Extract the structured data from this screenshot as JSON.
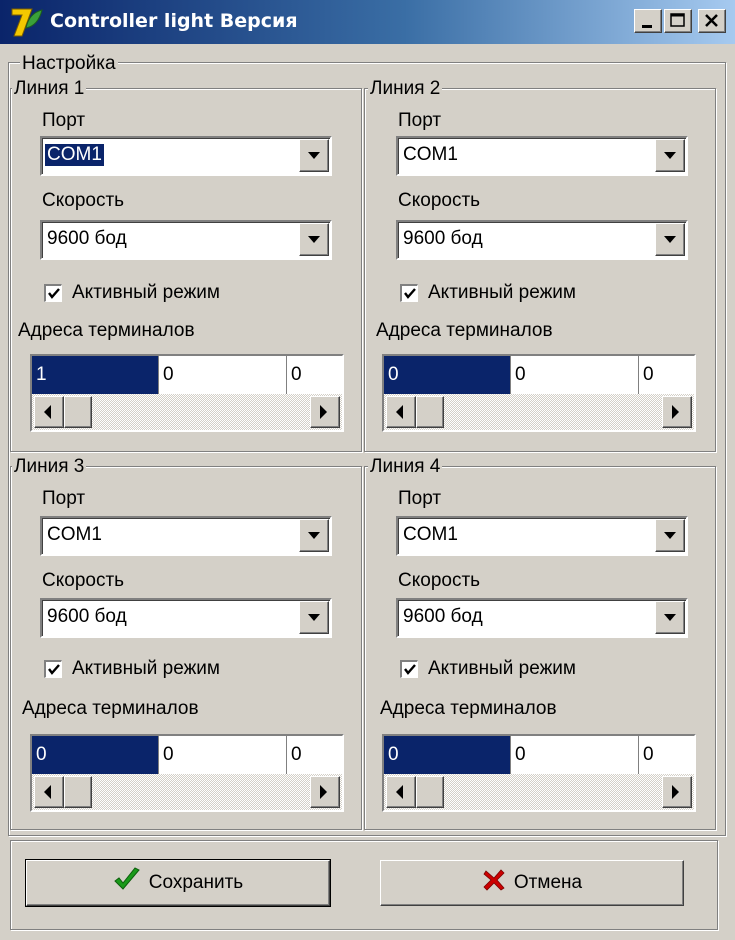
{
  "window": {
    "title": "Controller light Версия",
    "icon": "app-7-icon",
    "controls": [
      "minimize-icon",
      "maximize-icon",
      "close-icon"
    ]
  },
  "settings": {
    "group_label": "Настройка",
    "lines": [
      {
        "title": "Линия 1",
        "port_label": "Порт",
        "port_value": "COM1",
        "speed_label": "Скорость",
        "speed_value": "9600 бод",
        "active_label": "Активный режим",
        "active_checked": true,
        "addresses_label": "Адреса терминалов",
        "addresses": [
          "1",
          "0",
          "0"
        ]
      },
      {
        "title": "Линия 2",
        "port_label": "Порт",
        "port_value": "COM1",
        "speed_label": "Скорость",
        "speed_value": "9600 бод",
        "active_label": "Активный режим",
        "active_checked": true,
        "addresses_label": "Адреса терминалов",
        "addresses": [
          "0",
          "0",
          "0"
        ]
      },
      {
        "title": "Линия 3",
        "port_label": "Порт",
        "port_value": "COM1",
        "speed_label": "Скорость",
        "speed_value": "9600 бод",
        "active_label": "Активный режим",
        "active_checked": true,
        "addresses_label": "Адреса терминалов",
        "addresses": [
          "0",
          "0",
          "0"
        ]
      },
      {
        "title": "Линия 4",
        "port_label": "Порт",
        "port_value": "COM1",
        "speed_label": "Скорость",
        "speed_value": "9600 бод",
        "active_label": "Активный режим",
        "active_checked": true,
        "addresses_label": "Адреса терминалов",
        "addresses": [
          "0",
          "0",
          "0"
        ]
      }
    ]
  },
  "buttons": {
    "save_label": "Сохранить",
    "save_icon": "checkmark-icon",
    "cancel_label": "Отмена",
    "cancel_icon": "x-icon"
  },
  "colors": {
    "window_bg": "#d4d0c8",
    "title_bar_start": "#0a246a",
    "title_bar_end": "#a6caf0",
    "selection": "#0a246a",
    "save_icon": "#1a9a1a",
    "cancel_icon": "#cc0000"
  }
}
